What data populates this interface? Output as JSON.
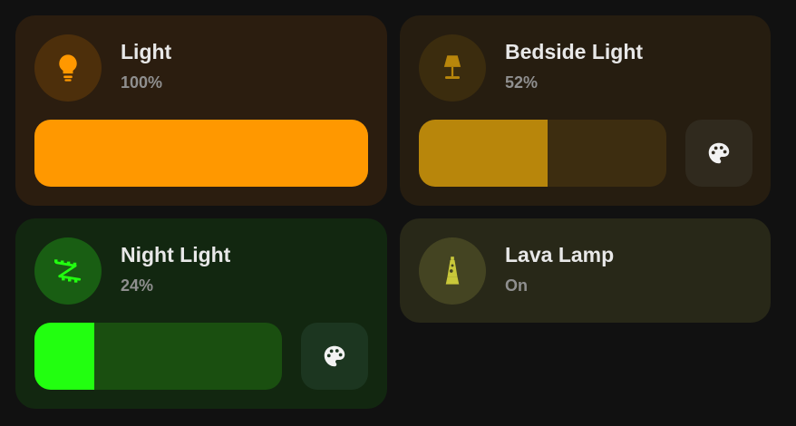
{
  "cards": [
    {
      "name": "Light",
      "state": "100%",
      "brightness_percent": 100,
      "icon": "lightbulb-icon",
      "accent": "#ff9800"
    },
    {
      "name": "Bedside Light",
      "state": "52%",
      "brightness_percent": 52,
      "icon": "floor-lamp-icon",
      "accent": "#b8860b"
    },
    {
      "name": "Night Light",
      "state": "24%",
      "brightness_percent": 24,
      "icon": "led-strip-icon",
      "accent": "#22ff10"
    },
    {
      "name": "Lava Lamp",
      "state": "On",
      "icon": "lava-lamp-icon",
      "accent": "#c9c83a"
    }
  ]
}
